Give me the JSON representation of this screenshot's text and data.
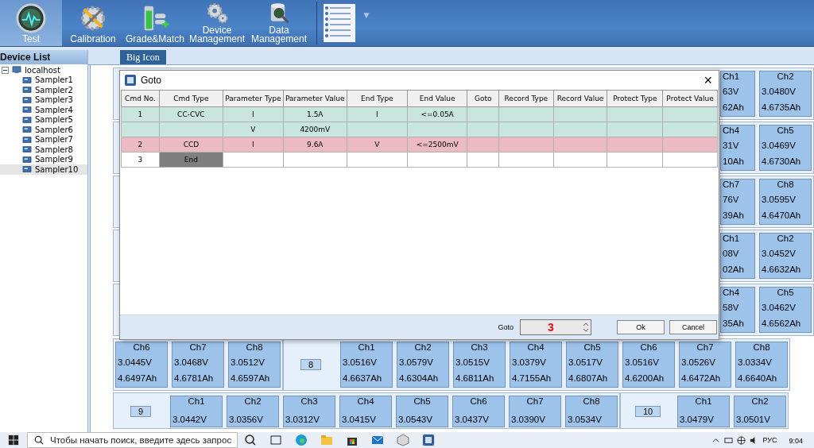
{
  "toolbar": {
    "items": [
      {
        "label": "Test",
        "selected": true
      },
      {
        "label": "Calibration",
        "selected": false
      },
      {
        "label": "Grade&Match",
        "selected": false
      },
      {
        "label": "Device Management",
        "selected": false
      },
      {
        "label": "Data Management",
        "selected": false
      }
    ],
    "more": "▼"
  },
  "device_list": {
    "title": "Device List",
    "tree": [
      {
        "label": "localhost",
        "expanded": true,
        "selected": false,
        "children": [
          {
            "label": "Sampler1",
            "selected": false
          },
          {
            "label": "Sampler2",
            "selected": false
          },
          {
            "label": "Sampler3",
            "selected": false
          },
          {
            "label": "Sampler4",
            "selected": false
          },
          {
            "label": "Sampler5",
            "selected": false
          },
          {
            "label": "Sampler6",
            "selected": false
          },
          {
            "label": "Sampler7",
            "selected": false
          },
          {
            "label": "Sampler8",
            "selected": false
          },
          {
            "label": "Sampler9",
            "selected": false
          },
          {
            "label": "Sampler10",
            "selected": true
          }
        ]
      }
    ]
  },
  "tabs": [
    {
      "label": "Big Icon",
      "selected": true
    }
  ],
  "channel_rows": [
    {
      "groups": [
        {
          "channels": [
            {
              "kind": "cut",
              "name": "Ch1",
              "voltage": "63V",
              "capacity": "62Ah"
            },
            {
              "kind": "full",
              "name": "Ch2",
              "voltage": "3.0480V",
              "capacity": "4.6735Ah"
            }
          ]
        }
      ]
    },
    {
      "groups": [
        {
          "channels": [
            {
              "kind": "cut",
              "name": "Ch4",
              "voltage": "31V",
              "capacity": "10Ah"
            },
            {
              "kind": "full",
              "name": "Ch5",
              "voltage": "3.0469V",
              "capacity": "4.6730Ah"
            }
          ]
        }
      ]
    },
    {
      "groups": [
        {
          "channels": [
            {
              "kind": "cut",
              "name": "Ch7",
              "voltage": "76V",
              "capacity": "39Ah"
            },
            {
              "kind": "full",
              "name": "Ch8",
              "voltage": "3.0595V",
              "capacity": "4.6470Ah"
            }
          ]
        }
      ]
    },
    {
      "groups": [
        {
          "channels": [
            {
              "kind": "cut",
              "name": "Ch1",
              "voltage": "08V",
              "capacity": "02Ah"
            },
            {
              "kind": "full",
              "name": "Ch2",
              "voltage": "3.0452V",
              "capacity": "4.6632Ah"
            }
          ]
        }
      ]
    },
    {
      "groups": [
        {
          "channels": [
            {
              "kind": "cut",
              "name": "Ch4",
              "voltage": "58V",
              "capacity": "35Ah"
            },
            {
              "kind": "full",
              "name": "Ch5",
              "voltage": "3.0462V",
              "capacity": "4.6562Ah"
            }
          ]
        }
      ]
    },
    {
      "groups": [
        {
          "channels": [
            {
              "kind": "full",
              "name": "Ch6",
              "voltage": "3.0445V",
              "capacity": "4.6497Ah"
            },
            {
              "kind": "full",
              "name": "Ch7",
              "voltage": "3.0468V",
              "capacity": "4.6781Ah"
            },
            {
              "kind": "full",
              "name": "Ch8",
              "voltage": "3.0512V",
              "capacity": "4.6597Ah"
            }
          ]
        },
        {
          "number": "8",
          "channels": [
            {
              "kind": "full",
              "name": "Ch1",
              "voltage": "3.0516V",
              "capacity": "4.6637Ah"
            },
            {
              "kind": "full",
              "name": "Ch2",
              "voltage": "3.0579V",
              "capacity": "4.6304Ah"
            },
            {
              "kind": "full",
              "name": "Ch3",
              "voltage": "3.0515V",
              "capacity": "4.6811Ah"
            },
            {
              "kind": "full",
              "name": "Ch4",
              "voltage": "3.0379V",
              "capacity": "4.7155Ah"
            },
            {
              "kind": "full",
              "name": "Ch5",
              "voltage": "3.0517V",
              "capacity": "4.6807Ah"
            },
            {
              "kind": "full",
              "name": "Ch6",
              "voltage": "3.0516V",
              "capacity": "4.6200Ah"
            },
            {
              "kind": "full",
              "name": "Ch7",
              "voltage": "3.0526V",
              "capacity": "4.6472Ah"
            },
            {
              "kind": "full",
              "name": "Ch8",
              "voltage": "3.0334V",
              "capacity": "4.6640Ah"
            }
          ]
        }
      ]
    },
    {
      "groups": [
        {
          "number": "9",
          "channels": [
            {
              "kind": "full",
              "name": "Ch1",
              "voltage": "3.0442V"
            },
            {
              "kind": "full",
              "name": "Ch2",
              "voltage": "3.0356V"
            },
            {
              "kind": "full",
              "name": "Ch3",
              "voltage": "3.0312V"
            },
            {
              "kind": "full",
              "name": "Ch4",
              "voltage": "3.0415V"
            },
            {
              "kind": "full",
              "name": "Ch5",
              "voltage": "3.0543V"
            },
            {
              "kind": "full",
              "name": "Ch6",
              "voltage": "3.0437V"
            },
            {
              "kind": "full",
              "name": "Ch7",
              "voltage": "3.0390V"
            },
            {
              "kind": "full",
              "name": "Ch8",
              "voltage": "3.0534V"
            }
          ]
        },
        {
          "number": "10",
          "channels": [
            {
              "kind": "full",
              "name": "Ch1",
              "voltage": "3.0479V"
            },
            {
              "kind": "full",
              "name": "Ch2",
              "voltage": "3.0501V"
            }
          ]
        }
      ]
    }
  ],
  "dialog": {
    "title": "Goto",
    "close": "×",
    "columns": [
      "Cmd No.",
      "Cmd Type",
      "Parameter Type",
      "Parameter Value",
      "End Type",
      "End Value",
      "Goto",
      "Record Type",
      "Record Value",
      "Protect Type",
      "Protect Value"
    ],
    "rows": [
      {
        "color": "#c8e6de",
        "cmd_type_shaded": false,
        "cmd_no": "1",
        "cmd_type": "CC-CVC",
        "parameter_type": "I",
        "parameter_value": "1.5A",
        "end_type": "I",
        "end_value": "<=0.05A"
      },
      {
        "color": "#c8e6de",
        "cmd_type_shaded": false,
        "parameter_type": "V",
        "parameter_value": "4200mV"
      },
      {
        "color": "#ecbac2",
        "cmd_type_shaded": false,
        "cmd_no": "2",
        "cmd_type": "CCD",
        "parameter_type": "I",
        "parameter_value": "9.6A",
        "end_type": "V",
        "end_value": "<=2500mV"
      },
      {
        "color": "#ffffff",
        "cmd_type_shaded": true,
        "cmd_no": "3",
        "cmd_type": "End"
      }
    ],
    "goto_label": "Goto",
    "goto_value": "3",
    "ok": "Ok",
    "cancel": "Cancel"
  },
  "taskbar": {
    "search_placeholder": "Чтобы начать поиск, введите здесь запрос",
    "language": "РУС",
    "time": "9:04"
  }
}
